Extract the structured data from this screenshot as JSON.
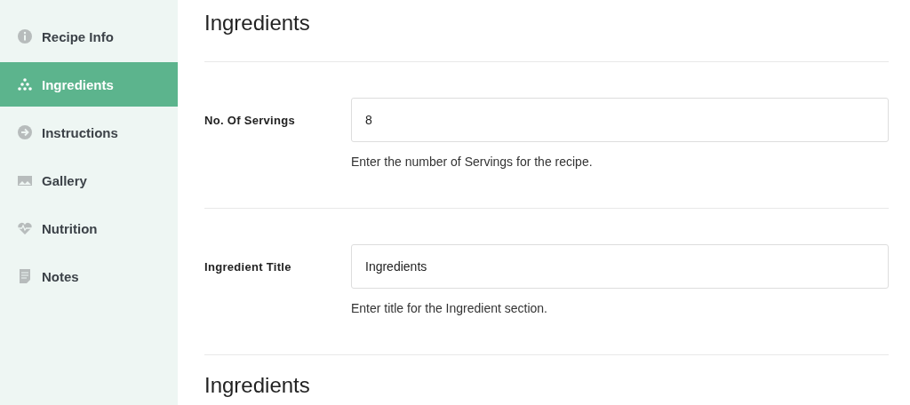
{
  "sidebar": {
    "items": [
      {
        "label": "Recipe Info",
        "kind": "info",
        "selected": false
      },
      {
        "label": "Ingredients",
        "kind": "dots",
        "selected": true
      },
      {
        "label": "Instructions",
        "kind": "arrow",
        "selected": false
      },
      {
        "label": "Gallery",
        "kind": "image",
        "selected": false
      },
      {
        "label": "Nutrition",
        "kind": "heart",
        "selected": false
      },
      {
        "label": "Notes",
        "kind": "note",
        "selected": false
      }
    ]
  },
  "main": {
    "title": "Ingredients",
    "fields": [
      {
        "label": "No. Of Servings",
        "value": "8",
        "help": "Enter the number of Servings for the recipe."
      },
      {
        "label": "Ingredient Title",
        "value": "Ingredients",
        "help": "Enter title for the Ingredient section."
      }
    ],
    "section_title": "Ingredients"
  }
}
